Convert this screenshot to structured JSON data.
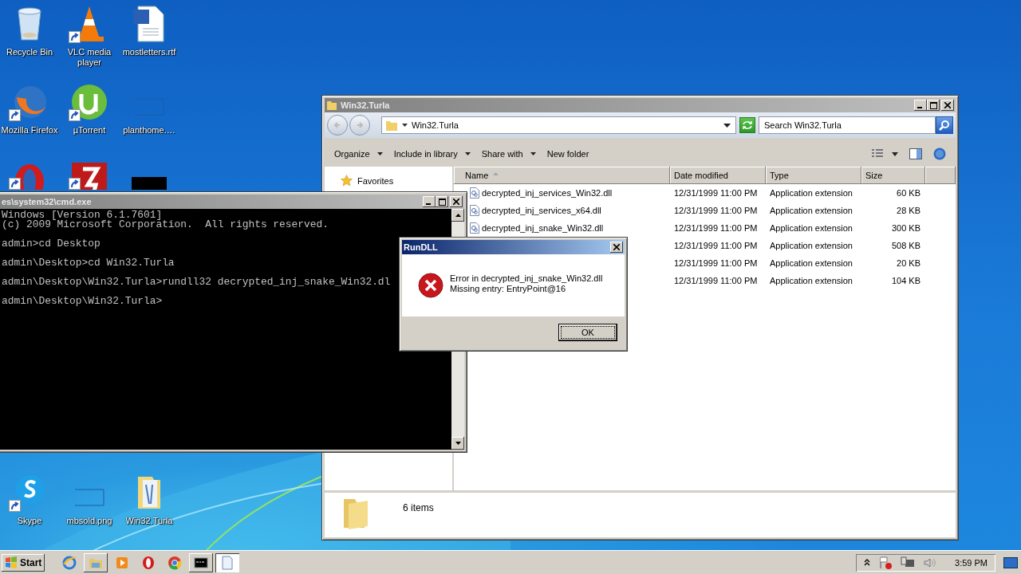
{
  "desktop_icons": [
    {
      "kind": "recycle-bin",
      "label": "Recycle Bin",
      "shortcut": false
    },
    {
      "kind": "cone",
      "label": "VLC media player",
      "shortcut": true
    },
    {
      "kind": "document",
      "label": "mostletters.rtf",
      "shortcut": false
    },
    {
      "kind": "fox",
      "label": "Mozilla Firefox",
      "shortcut": true
    },
    {
      "kind": "torrent",
      "label": "µTorrent",
      "shortcut": true
    },
    {
      "kind": "thumbnail",
      "label": "planthome.…",
      "shortcut": false
    },
    {
      "kind": "opera",
      "shortcut": true
    },
    {
      "kind": "filezilla",
      "shortcut": true
    },
    {
      "kind": "dark",
      "shortcut": false
    },
    {
      "kind": "skype",
      "label": "Skype",
      "shortcut": true
    },
    {
      "kind": "thumbnail",
      "label": "mbsold.png",
      "shortcut": false
    },
    {
      "kind": "folder",
      "label": "Win32.Turla",
      "shortcut": false
    }
  ],
  "explorer": {
    "title": "Win32.Turla",
    "address": "Win32.Turla",
    "search": {
      "placeholder": "Search Win32.Turla"
    },
    "toolbar": [
      {
        "label": "Organize",
        "menu": true
      },
      {
        "label": "Include in library",
        "menu": true
      },
      {
        "label": "Share with",
        "menu": true
      },
      {
        "label": "New folder",
        "menu": false
      }
    ],
    "sidebar": [
      {
        "label": "Favorites"
      }
    ],
    "columns": [
      {
        "label": "Name",
        "sorted": true
      },
      {
        "label": "Date modified",
        "sorted": false
      },
      {
        "label": "Type",
        "sorted": false
      },
      {
        "label": "Size",
        "sorted": false
      }
    ],
    "files": [
      {
        "name": "decrypted_inj_services_Win32.dll",
        "date": "12/31/1999 11:00 PM",
        "type": "Application extension",
        "size": "60 KB"
      },
      {
        "name": "decrypted_inj_services_x64.dll",
        "date": "12/31/1999 11:00 PM",
        "type": "Application extension",
        "size": "28 KB"
      },
      {
        "name": "decrypted_inj_snake_Win32.dll",
        "date": "12/31/1999 11:00 PM",
        "type": "Application extension",
        "size": "300 KB"
      },
      {
        "date": "12/31/1999 11:00 PM",
        "type": "Application extension",
        "size": "508 KB"
      },
      {
        "date": "12/31/1999 11:00 PM",
        "type": "Application extension",
        "size": "20 KB"
      },
      {
        "date": "12/31/1999 11:00 PM",
        "type": "Application extension",
        "size": "104 KB"
      }
    ],
    "status": "6 items"
  },
  "console": {
    "title": "es\\system32\\cmd.exe",
    "blocks": [
      [
        "Windows [Version 6.1.7601]",
        "(c) 2009 Microsoft Corporation.  All rights reserved."
      ],
      [
        "admin>cd Desktop"
      ],
      [
        "admin\\Desktop>cd Win32.Turla"
      ],
      [
        "admin\\Desktop\\Win32.Turla>rundll32 decrypted_inj_snake_Win32.dl"
      ],
      [
        "admin\\Desktop\\Win32.Turla>"
      ]
    ]
  },
  "dialog": {
    "title": "RunDLL",
    "message": [
      "Error in decrypted_inj_snake_Win32.dll",
      "Missing entry: EntryPoint@16"
    ],
    "button": "OK"
  },
  "taskbar": {
    "start": "Start",
    "apps": [
      {
        "kind": "ie",
        "open": false,
        "selected": false
      },
      {
        "kind": "explorer",
        "open": true,
        "selected": false
      },
      {
        "kind": "media",
        "open": false,
        "selected": false
      },
      {
        "kind": "opera",
        "open": false,
        "selected": false
      },
      {
        "kind": "chrome",
        "open": false,
        "selected": false
      },
      {
        "kind": "console",
        "open": true,
        "selected": false
      },
      {
        "kind": "notepad",
        "open": true,
        "selected": true
      }
    ],
    "clock": "3:59 PM"
  }
}
